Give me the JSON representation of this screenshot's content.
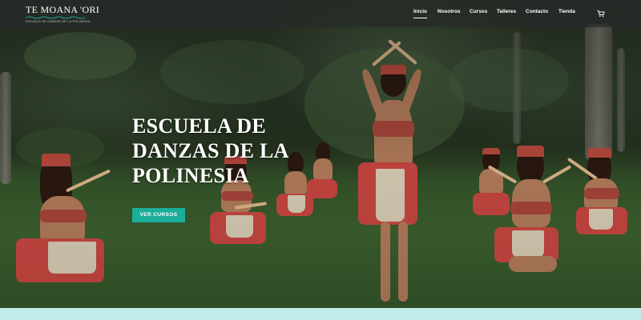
{
  "brand": {
    "name": "TE MOANA 'ORI",
    "tagline": "ESCUELA DE DANZAS DE LA POLINESIA",
    "accent_color": "#1aae9b"
  },
  "nav": {
    "items": [
      {
        "label": "Inicio",
        "active": true
      },
      {
        "label": "Nosotros",
        "active": false
      },
      {
        "label": "Cursos",
        "active": false
      },
      {
        "label": "Talleres",
        "active": false
      },
      {
        "label": "Contacto",
        "active": false
      },
      {
        "label": "Tienda",
        "active": false
      }
    ],
    "cart_icon": "cart-icon"
  },
  "hero": {
    "title_lines": [
      "ESCUELA DE",
      "DANZAS DE LA",
      "POLINESIA"
    ],
    "cta_label": "VER CURSOS"
  }
}
